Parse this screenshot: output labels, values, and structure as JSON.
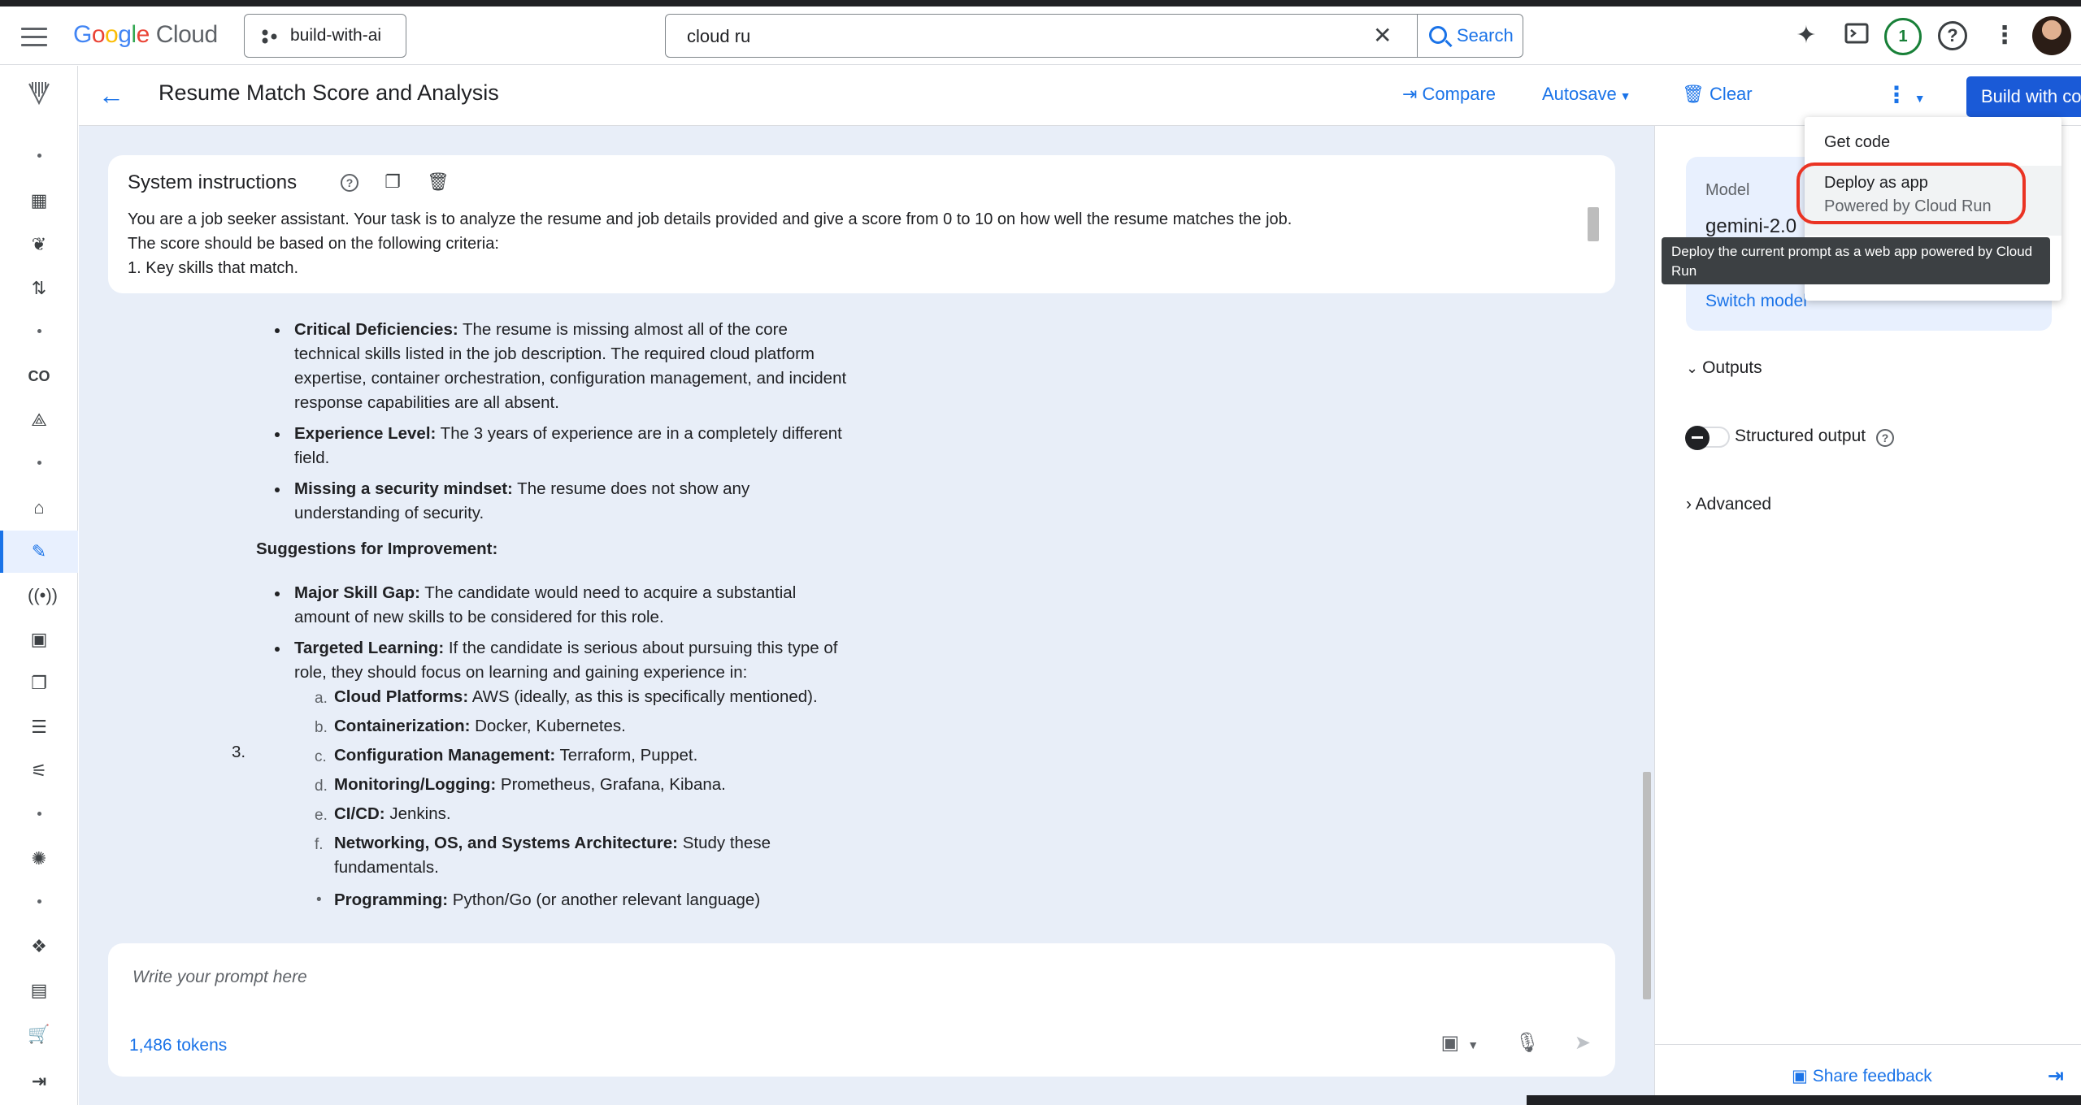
{
  "topbar": {
    "brand_google": "Google",
    "brand_cloud": "Cloud",
    "project": "build-with-ai",
    "search_value": "cloud ru",
    "search_button": "Search",
    "notification_count": "1"
  },
  "header": {
    "title": "Resume Match Score and Analysis",
    "compare": "Compare",
    "autosave": "Autosave",
    "clear": "Clear",
    "build_with_code": "Build with code"
  },
  "system_instructions": {
    "title": "System instructions",
    "lines": [
      "You are a job seeker assistant. Your task is to analyze the resume and job details provided and give a score from 0 to 10 on how well the resume matches the job.",
      "The score should be based on the following criteria:",
      "1. Key skills that match."
    ]
  },
  "response": {
    "b1_label": "Critical Deficiencies:",
    "b1_text": " The resume is missing almost all of the core technical skills listed in the job description. The required cloud platform expertise, container orchestration, configuration management, and incident response capabilities are all absent.",
    "b2_label": "Experience Level:",
    "b2_text": " The 3 years of experience are in a completely different field.",
    "b3_label": "Missing a security mindset:",
    "b3_text": " The resume does not show any understanding of security.",
    "section3_num": "3.",
    "section3_title": "Suggestions for Improvement:",
    "b4_label": "Major Skill Gap:",
    "b4_text": " The candidate would need to acquire a substantial amount of new skills to be considered for this role.",
    "b5_label": "Targeted Learning:",
    "b5_text": " If the candidate is serious about pursuing this type of role, they should focus on learning and gaining experience in:",
    "sub_items": [
      {
        "letter": "a.",
        "label": "Cloud Platforms:",
        "text": " AWS (ideally, as this is specifically mentioned)."
      },
      {
        "letter": "b.",
        "label": "Containerization:",
        "text": " Docker, Kubernetes."
      },
      {
        "letter": "c.",
        "label": "Configuration Management:",
        "text": " Terraform, Puppet."
      },
      {
        "letter": "d.",
        "label": "Monitoring/Logging:",
        "text": " Prometheus, Grafana, Kibana."
      },
      {
        "letter": "e.",
        "label": "CI/CD:",
        "text": " Jenkins."
      },
      {
        "letter": "f.",
        "label": "Networking, OS, and Systems Architecture:",
        "text": " Study these fundamentals."
      }
    ],
    "b6_label": "Programming:",
    "b6_text": " Python/Go (or another relevant language)"
  },
  "prompt": {
    "placeholder": "Write your prompt here",
    "tokens": "1,486 tokens"
  },
  "right_panel": {
    "model_label": "Model",
    "model_name": "gemini-2.0",
    "switch_model": "Switch model",
    "outputs": "Outputs",
    "structured_output": "Structured output",
    "advanced": "Advanced",
    "share_feedback": "Share feedback"
  },
  "menu": {
    "get_code": "Get code",
    "deploy_as_app": "Deploy as app",
    "deploy_sub": "Powered by Cloud Run",
    "tooltip": "Deploy the current prompt as a web app powered by Cloud Run"
  },
  "colors": {
    "accent": "#1a73e8",
    "build_button": "#1a5ad7",
    "highlight_ring": "#ea3323",
    "content_bg": "#e8eef8"
  }
}
